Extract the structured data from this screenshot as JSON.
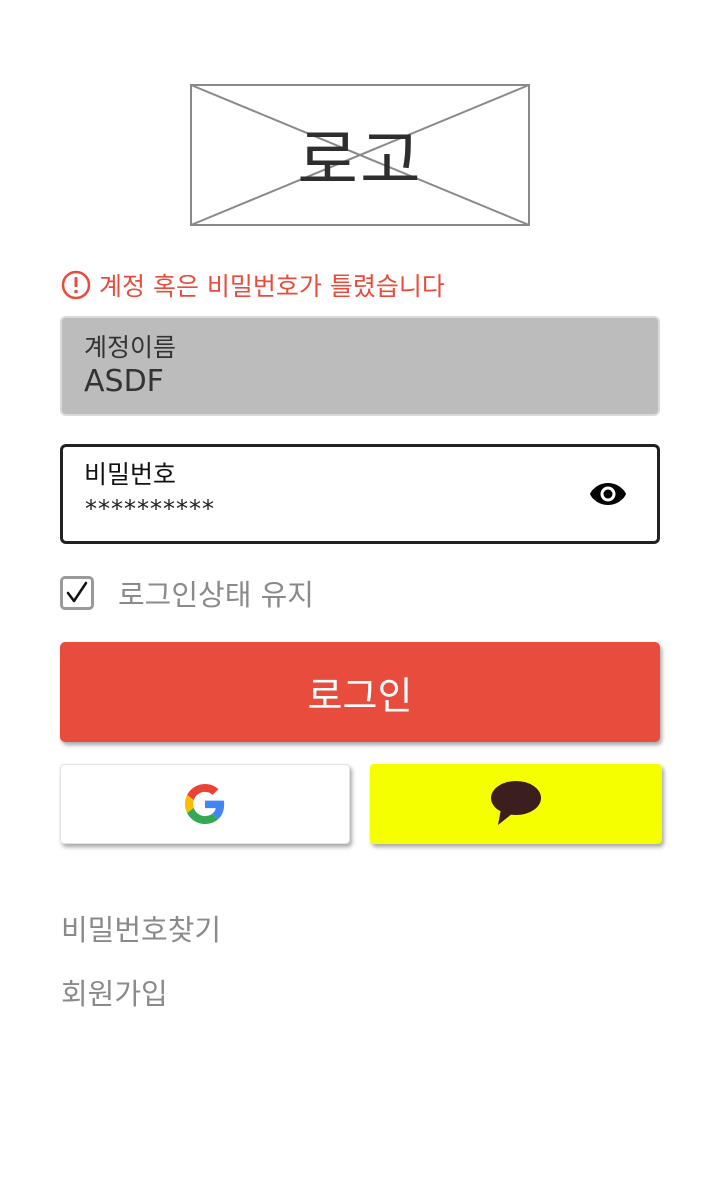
{
  "logo": {
    "text": "로고"
  },
  "error": {
    "message": "계정 혹은 비밀번호가 틀렸습니다",
    "icon": "exclamation-circle-icon",
    "color": "#e74c3c"
  },
  "username_field": {
    "label": "계정이름",
    "value": "ASDF"
  },
  "password_field": {
    "label": "비밀번호",
    "value": "**********",
    "toggle_icon": "eye-icon"
  },
  "remember": {
    "label": "로그인상태 유지",
    "checked": true
  },
  "login_button": {
    "label": "로그인",
    "color": "#e74c3c"
  },
  "social": {
    "google_icon": "google-icon",
    "kakao_icon": "kakao-speech-bubble-icon",
    "kakao_color": "#f5ff00"
  },
  "links": {
    "find_password": "비밀번호찾기",
    "signup": "회원가입"
  }
}
